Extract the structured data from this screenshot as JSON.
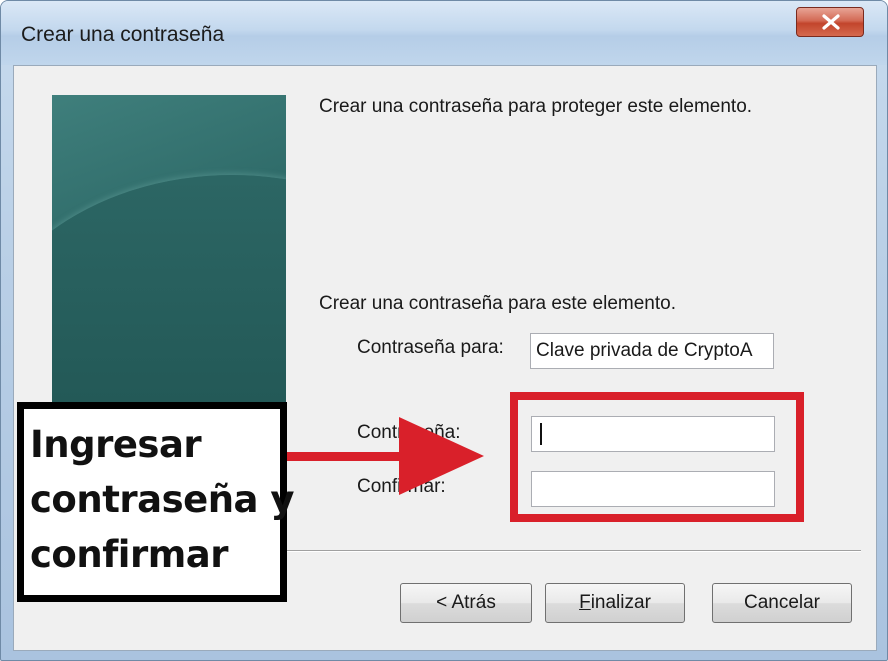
{
  "window": {
    "title": "Crear una contraseña",
    "close_icon": "close-icon"
  },
  "content": {
    "intro": "Crear una contraseña para proteger este elemento.",
    "section_label": "Crear una contraseña para este elemento.",
    "password_for_label": "Contraseña para:",
    "password_for_value": "Clave privada de CryptoA",
    "password_label": "Contraseña:",
    "password_value": "",
    "confirm_label": "Confirmar:",
    "confirm_value": ""
  },
  "buttons": {
    "back": "< Atrás",
    "finish_mnemonic": "F",
    "finish_rest": "inalizar",
    "cancel": "Cancelar"
  },
  "annotation": {
    "line1": "Ingresar",
    "line2": "contraseña y",
    "line3": "confirmar",
    "highlight_color": "#d9202a",
    "arrow_color": "#d9202a"
  }
}
